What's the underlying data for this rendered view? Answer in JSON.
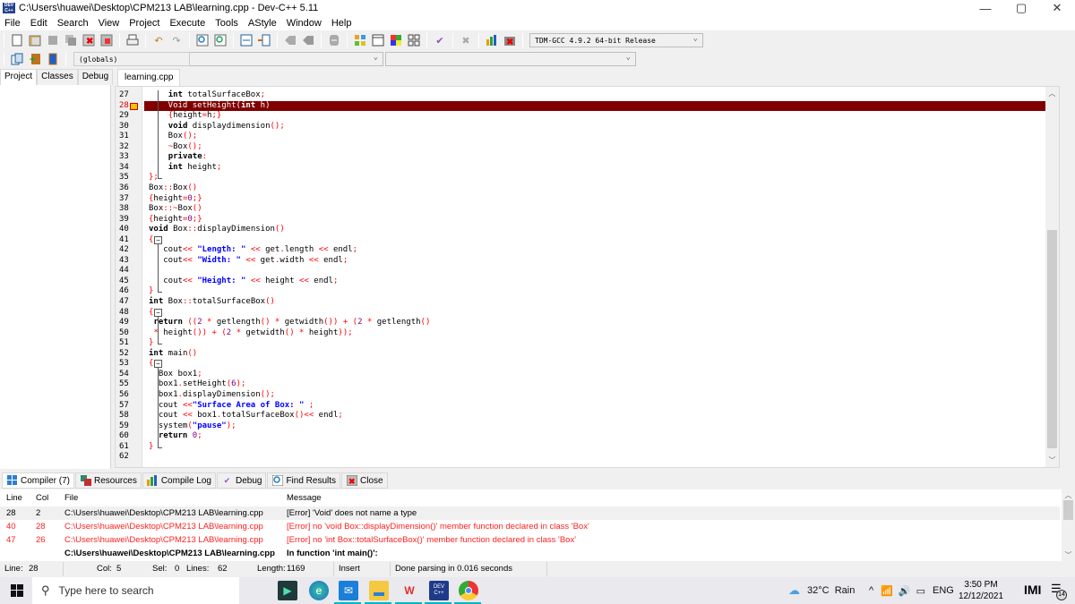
{
  "window": {
    "title": "C:\\Users\\huawei\\Desktop\\CPM213 LAB\\learning.cpp - Dev-C++ 5.11",
    "app_icon_text": "DEV C++",
    "controls": {
      "minimize": "—",
      "maximize": "▢",
      "close": "✕"
    }
  },
  "menu": [
    "File",
    "Edit",
    "Search",
    "View",
    "Project",
    "Execute",
    "Tools",
    "AStyle",
    "Window",
    "Help"
  ],
  "toolbar": {
    "icons": [
      "new-file-icon",
      "open-icon",
      "save-icon",
      "save-all-icon",
      "close-file-icon",
      "close-all-icon",
      "print-icon",
      "undo-icon",
      "redo-icon",
      "find-icon",
      "replace-icon",
      "indent-icon",
      "unindent-icon",
      "goto-prev-icon",
      "goto-next-icon",
      "bookmark-icon",
      "new-project-icon",
      "project-options-icon",
      "compile-icon",
      "compile-run-icon",
      "check-syntax-icon",
      "stop-icon",
      "profile-icon",
      "delete-profile-icon"
    ],
    "compiler_select": "TDM-GCC 4.9.2 64-bit Release",
    "scope_select": "(globals)",
    "member_select": ""
  },
  "left_panel": {
    "tabs": [
      "Project",
      "Classes",
      "Debug"
    ],
    "active_tab": "Project"
  },
  "editor": {
    "file_tab": "learning.cpp",
    "error_line": 28,
    "lines": [
      {
        "n": "27",
        "code": "    int totalSurfaceBox;"
      },
      {
        "n": "28",
        "code": "    Void setHeight(int h)"
      },
      {
        "n": "29",
        "code": "    {height=h;}"
      },
      {
        "n": "30",
        "code": "    void displaydimension();"
      },
      {
        "n": "31",
        "code": "    Box();"
      },
      {
        "n": "32",
        "code": "    ~Box();"
      },
      {
        "n": "33",
        "code": "    private:"
      },
      {
        "n": "34",
        "code": "    int height;"
      },
      {
        "n": "35",
        "code": "};"
      },
      {
        "n": "36",
        "code": "Box::Box()"
      },
      {
        "n": "37",
        "code": "{height=0;}"
      },
      {
        "n": "38",
        "code": "Box::~Box()"
      },
      {
        "n": "39",
        "code": "{height=0;}"
      },
      {
        "n": "40",
        "code": "void Box::displayDimension()"
      },
      {
        "n": "41",
        "code": "{"
      },
      {
        "n": "42",
        "code": "   cout<< \"Length: \" << get.length << endl;"
      },
      {
        "n": "43",
        "code": "   cout<< \"Width: \" << get.width << endl;"
      },
      {
        "n": "44",
        "code": ""
      },
      {
        "n": "45",
        "code": "   cout<< \"Height: \" << height << endl;"
      },
      {
        "n": "46",
        "code": "}"
      },
      {
        "n": "47",
        "code": "int Box::totalSurfaceBox()"
      },
      {
        "n": "48",
        "code": "{"
      },
      {
        "n": "49",
        "code": " return ((2 * getlength() * getwidth()) + (2 * getlength()"
      },
      {
        "n": "50",
        "code": " * height()) + (2 * getwidth() * height));"
      },
      {
        "n": "51",
        "code": "}"
      },
      {
        "n": "52",
        "code": "int main()"
      },
      {
        "n": "53",
        "code": "{"
      },
      {
        "n": "54",
        "code": "  Box box1;"
      },
      {
        "n": "55",
        "code": "  box1.setHeight(6);"
      },
      {
        "n": "56",
        "code": "  box1.displayDimension();"
      },
      {
        "n": "57",
        "code": "  cout <<\"Surface Area of Box: \" ;"
      },
      {
        "n": "58",
        "code": "  cout << box1.totalSurfaceBox()<< endl;"
      },
      {
        "n": "59",
        "code": "  system(\"pause\");"
      },
      {
        "n": "60",
        "code": "  return 0;"
      },
      {
        "n": "61",
        "code": "}"
      },
      {
        "n": "62",
        "code": ""
      }
    ]
  },
  "bottom_tabs": [
    {
      "label": "Compiler (7)",
      "icon": "compiler-icon"
    },
    {
      "label": "Resources",
      "icon": "resources-icon"
    },
    {
      "label": "Compile Log",
      "icon": "compile-log-icon"
    },
    {
      "label": "Debug",
      "icon": "debug-check-icon"
    },
    {
      "label": "Find Results",
      "icon": "find-results-icon"
    },
    {
      "label": "Close",
      "icon": "close-panel-icon"
    }
  ],
  "messages": {
    "headers": {
      "line": "Line",
      "col": "Col",
      "file": "File",
      "message": "Message"
    },
    "rows": [
      {
        "line": "28",
        "col": "2",
        "file": "C:\\Users\\huawei\\Desktop\\CPM213 LAB\\learning.cpp",
        "message": "[Error] 'Void' does not name a type",
        "style": "selected"
      },
      {
        "line": "40",
        "col": "28",
        "file": "C:\\Users\\huawei\\Desktop\\CPM213 LAB\\learning.cpp",
        "message": "[Error] no 'void Box::displayDimension()' member function declared in class 'Box'",
        "style": "error"
      },
      {
        "line": "47",
        "col": "26",
        "file": "C:\\Users\\huawei\\Desktop\\CPM213 LAB\\learning.cpp",
        "message": "[Error] no 'int Box::totalSurfaceBox()' member function declared in class 'Box'",
        "style": "error"
      },
      {
        "line": "",
        "col": "",
        "file": "C:\\Users\\huawei\\Desktop\\CPM213 LAB\\learning.cpp",
        "message": "In function 'int main()':",
        "style": "bold"
      }
    ]
  },
  "status": {
    "line_label": "Line:",
    "line": "28",
    "col_label": "Col:",
    "col": "5",
    "sel_label": "Sel:",
    "sel": "0",
    "lines_label": "Lines:",
    "lines": "62",
    "length_label": "Length:",
    "length": "1169",
    "mode": "Insert",
    "message": "Done parsing in 0.016 seconds"
  },
  "taskbar": {
    "search_placeholder": "Type here to search",
    "apps": [
      "filmora-icon",
      "edge-icon",
      "mail-icon",
      "file-explorer-icon",
      "wps-icon",
      "devcpp-icon",
      "chrome-icon"
    ],
    "weather": "32°C  Rain",
    "language": "ENG",
    "time": "3:50 PM",
    "date": "12/12/2021",
    "notifications": "14"
  },
  "colors": {
    "error_line_bg": "#800000",
    "error_text": "#ff2020",
    "string": "#0000ff",
    "symbol": "#ff0000",
    "number": "#800080"
  }
}
